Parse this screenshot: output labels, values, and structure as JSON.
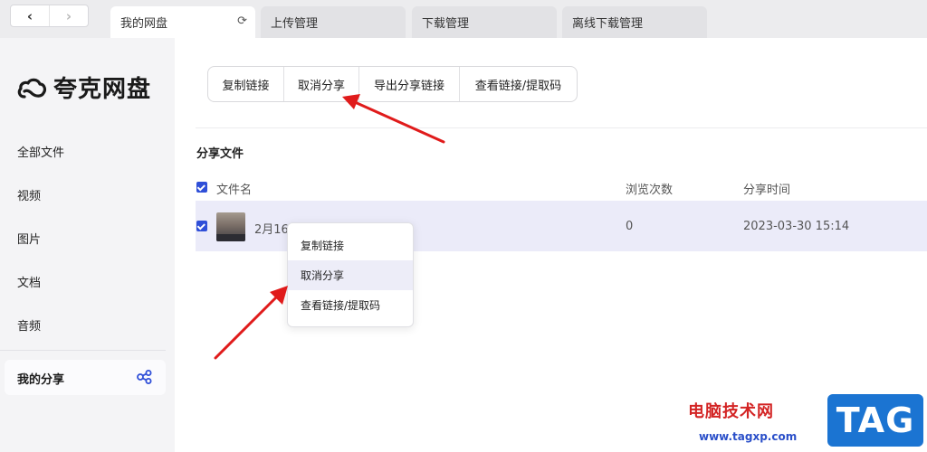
{
  "nav": {
    "back": "‹",
    "forward": "›"
  },
  "tabs": [
    {
      "label": "我的网盘",
      "active": true
    },
    {
      "label": "上传管理",
      "active": false
    },
    {
      "label": "下载管理",
      "active": false
    },
    {
      "label": "离线下载管理",
      "active": false
    }
  ],
  "sidebar": {
    "logo": "夸克网盘",
    "items": [
      "全部文件",
      "视频",
      "图片",
      "文档",
      "音频"
    ],
    "active_item": "我的分享"
  },
  "toolbar": [
    "复制链接",
    "取消分享",
    "导出分享链接",
    "查看链接/提取码"
  ],
  "section_title": "分享文件",
  "table": {
    "headers": [
      "文件名",
      "浏览次数",
      "分享时间"
    ],
    "rows": [
      {
        "name": "2月16日",
        "views": "0",
        "time": "2023-03-30 15:14"
      }
    ]
  },
  "context_menu": [
    "复制链接",
    "取消分享",
    "查看链接/提取码"
  ],
  "watermark": {
    "text": "电脑技术网",
    "url": "www.tagxp.com",
    "tag": "TAG"
  },
  "colors": {
    "accent": "#2f4fd8",
    "row_highlight": "#ebebf9",
    "arrow": "#e01b1b"
  }
}
